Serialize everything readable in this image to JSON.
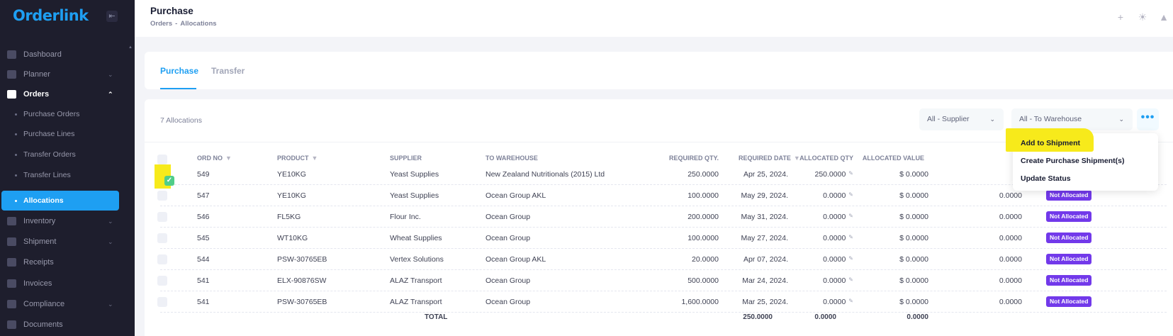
{
  "app": {
    "logo": "Orderlink"
  },
  "sidebar": {
    "items": [
      {
        "label": "Dashboard",
        "icon": "dashboard-icon",
        "chevron": ""
      },
      {
        "label": "Planner",
        "icon": "planner-icon",
        "chevron": "⌄"
      },
      {
        "label": "Orders",
        "icon": "cart-icon",
        "chevron": "⌃"
      },
      {
        "label": "Inventory",
        "icon": "inventory-icon",
        "chevron": "⌄"
      },
      {
        "label": "Shipment",
        "icon": "shipment-icon",
        "chevron": "⌄"
      },
      {
        "label": "Receipts",
        "icon": "receipts-icon",
        "chevron": ""
      },
      {
        "label": "Invoices",
        "icon": "invoices-icon",
        "chevron": ""
      },
      {
        "label": "Compliance",
        "icon": "compliance-icon",
        "chevron": "⌄"
      },
      {
        "label": "Documents",
        "icon": "documents-icon",
        "chevron": ""
      }
    ],
    "orders_subitems": [
      {
        "label": "Purchase Orders"
      },
      {
        "label": "Purchase Lines"
      },
      {
        "label": "Transfer Orders"
      },
      {
        "label": "Transfer Lines"
      },
      {
        "label": "Allocations"
      }
    ]
  },
  "header": {
    "title": "Purchase",
    "breadcrumb": [
      "Orders",
      "-",
      "Allocations"
    ]
  },
  "tabs": [
    {
      "label": "Purchase",
      "active": true
    },
    {
      "label": "Transfer",
      "active": false
    }
  ],
  "toolbar": {
    "count_label": "7 Allocations",
    "supplier_filter": "All - Supplier",
    "warehouse_filter": "All - To Warehouse",
    "more_label": "•••"
  },
  "table": {
    "columns": [
      "ORD NO",
      "PRODUCT",
      "SUPPLIER",
      "TO WAREHOUSE",
      "REQUIRED QTY.",
      "REQUIRED DATE",
      "ALLOCATED QTY",
      "ALLOCATED VALUE"
    ],
    "rows": [
      {
        "ord": "549",
        "product": "YE10KG",
        "supplier": "Yeast Supplies",
        "warehouse": "New Zealand Nutritionals (2015) Ltd",
        "req_qty": "250.0000",
        "req_date": "Apr 25, 2024.",
        "alloc_qty": "250.0000",
        "alloc_value": "$ 0.0000",
        "extra": "",
        "status": "",
        "checked": true
      },
      {
        "ord": "547",
        "product": "YE10KG",
        "supplier": "Yeast Supplies",
        "warehouse": "Ocean Group AKL",
        "req_qty": "100.0000",
        "req_date": "May 29, 2024.",
        "alloc_qty": "0.0000",
        "alloc_value": "$ 0.0000",
        "extra": "0.0000",
        "status": "Not Allocated",
        "checked": false
      },
      {
        "ord": "546",
        "product": "FL5KG",
        "supplier": "Flour Inc.",
        "warehouse": "Ocean Group",
        "req_qty": "200.0000",
        "req_date": "May 31, 2024.",
        "alloc_qty": "0.0000",
        "alloc_value": "$ 0.0000",
        "extra": "0.0000",
        "status": "Not Allocated",
        "checked": false
      },
      {
        "ord": "545",
        "product": "WT10KG",
        "supplier": "Wheat Supplies",
        "warehouse": "Ocean Group",
        "req_qty": "100.0000",
        "req_date": "May 27, 2024.",
        "alloc_qty": "0.0000",
        "alloc_value": "$ 0.0000",
        "extra": "0.0000",
        "status": "Not Allocated",
        "checked": false
      },
      {
        "ord": "544",
        "product": "PSW-30765EB",
        "supplier": "Vertex Solutions",
        "warehouse": "Ocean Group AKL",
        "req_qty": "20.0000",
        "req_date": "Apr 07, 2024.",
        "alloc_qty": "0.0000",
        "alloc_value": "$ 0.0000",
        "extra": "0.0000",
        "status": "Not Allocated",
        "checked": false
      },
      {
        "ord": "541",
        "product": "ELX-90876SW",
        "supplier": "ALAZ Transport",
        "warehouse": "Ocean Group",
        "req_qty": "500.0000",
        "req_date": "Mar 24, 2024.",
        "alloc_qty": "0.0000",
        "alloc_value": "$ 0.0000",
        "extra": "0.0000",
        "status": "Not Allocated",
        "checked": false
      },
      {
        "ord": "541",
        "product": "PSW-30765EB",
        "supplier": "ALAZ Transport",
        "warehouse": "Ocean Group",
        "req_qty": "1,600.0000",
        "req_date": "Mar 25, 2024.",
        "alloc_qty": "0.0000",
        "alloc_value": "$ 0.0000",
        "extra": "0.0000",
        "status": "Not Allocated",
        "checked": false
      }
    ],
    "totals": {
      "label": "TOTAL",
      "req_qty": "250.0000",
      "alloc_qty": "0.0000",
      "alloc_value": "0.0000"
    }
  },
  "action_menu": {
    "items": [
      "Add to Shipment",
      "Create Purchase Shipment(s)",
      "Update Status"
    ]
  },
  "colors": {
    "accent": "#1e9ff2",
    "sidebar": "#1e1e2d",
    "badge": "#7239ea",
    "highlight": "#f7ea1b",
    "check": "#50cd89"
  }
}
